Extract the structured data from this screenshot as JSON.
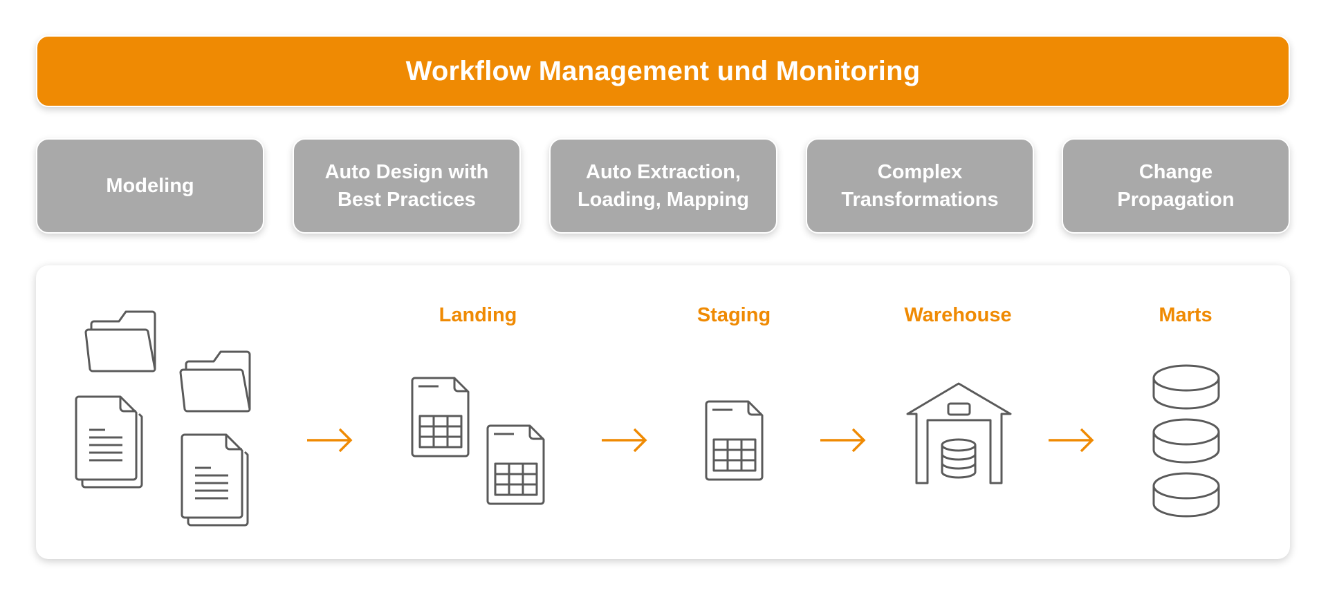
{
  "banner": {
    "title": "Workflow Management und Monitoring"
  },
  "capabilities": [
    {
      "label": "Modeling"
    },
    {
      "label": "Auto Design with\nBest Practices"
    },
    {
      "label": "Auto Extraction,\nLoading, Mapping"
    },
    {
      "label": "Complex\nTransformations"
    },
    {
      "label": "Change\nPropagation"
    }
  ],
  "pipeline": {
    "sources": {
      "icons": [
        "folder-icon",
        "folder-icon",
        "document-icon",
        "document-icon"
      ]
    },
    "stages": [
      {
        "label": "Landing",
        "icon": "spreadsheet-icon"
      },
      {
        "label": "Staging",
        "icon": "spreadsheet-icon"
      },
      {
        "label": "Warehouse",
        "icon": "warehouse-icon"
      },
      {
        "label": "Marts",
        "icon": "database-icon"
      }
    ],
    "arrow_icon": "arrow-right-icon"
  },
  "colors": {
    "accent": "#ef8a03",
    "capability_bg": "#a9a9a9",
    "icon_stroke": "#5a5a5a"
  }
}
